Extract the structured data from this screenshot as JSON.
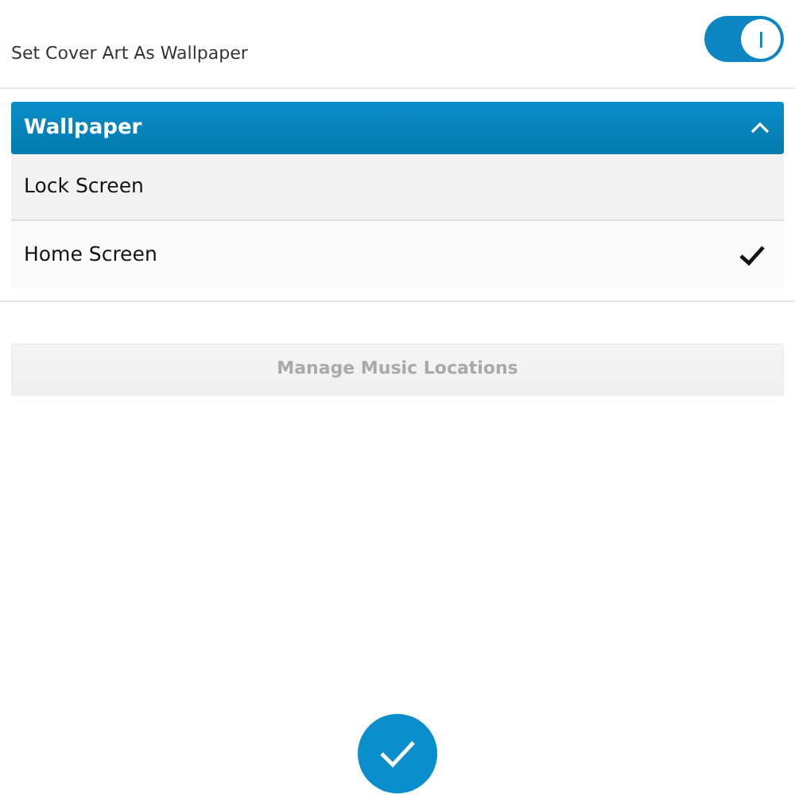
{
  "setting": {
    "label": "Set Cover Art As Wallpaper",
    "on": true
  },
  "dropdown": {
    "title": "Wallpaper",
    "expanded": true,
    "options": [
      {
        "label": "Lock Screen",
        "selected": false
      },
      {
        "label": "Home Screen",
        "selected": true
      }
    ]
  },
  "button": {
    "label": "Manage Music Locations",
    "disabled": true
  },
  "confirm": {
    "kind": "check"
  }
}
